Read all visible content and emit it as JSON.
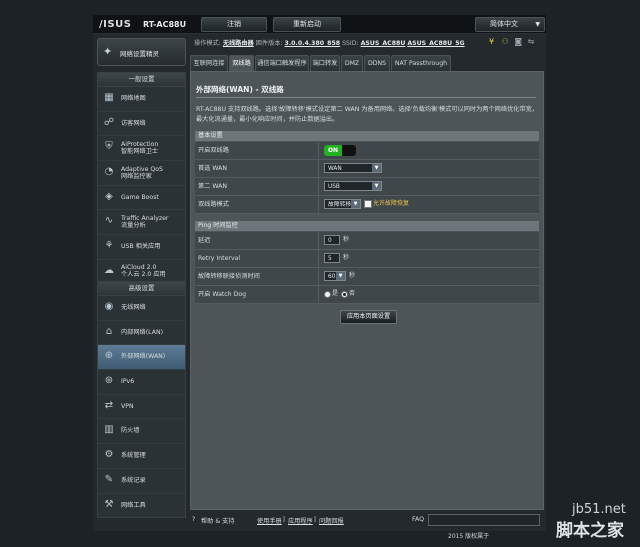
{
  "header": {
    "logo": "/ISUS",
    "model": "RT-AC88U",
    "logout": "注销",
    "reboot": "重新启动",
    "language": "简体中文"
  },
  "status": {
    "mode_label": "操作模式:",
    "mode_value": "无线路由器",
    "firmware_label": "固件版本:",
    "firmware_value": "3.0.0.4.380_858",
    "ssid_label": "SSID:",
    "ssid_1": "ASUS_AC88U",
    "ssid_2": "ASUS_AC88U_5G"
  },
  "nav": {
    "wizard": "网络设置精灵",
    "general_title": "一般设置",
    "general": [
      {
        "icon": "network-map-icon",
        "line1": "网络地图",
        "line2": ""
      },
      {
        "icon": "guest-network-icon",
        "line1": "访客网络",
        "line2": ""
      },
      {
        "icon": "aiprotection-icon",
        "line1": "AiProtection",
        "line2": "智能网络卫士"
      },
      {
        "icon": "adaptive-qos-icon",
        "line1": "Adaptive QoS",
        "line2": "网络监控家"
      },
      {
        "icon": "game-boost-icon",
        "line1": "Game Boost",
        "line2": ""
      },
      {
        "icon": "traffic-analyzer-icon",
        "line1": "Traffic Analyzer",
        "line2": "流量分析"
      },
      {
        "icon": "usb-icon",
        "line1": "USB 相关应用",
        "line2": ""
      },
      {
        "icon": "aicloud-icon",
        "line1": "AiCloud 2.0",
        "line2": "个人云 2.0 应用"
      }
    ],
    "advanced_title": "高级设置",
    "advanced": [
      {
        "icon": "wireless-icon",
        "line1": "无线网络"
      },
      {
        "icon": "lan-icon",
        "line1": "内部网络(LAN)"
      },
      {
        "icon": "wan-icon",
        "line1": "外部网络(WAN)"
      },
      {
        "icon": "ipv6-icon",
        "line1": "IPv6"
      },
      {
        "icon": "vpn-icon",
        "line1": "VPN"
      },
      {
        "icon": "firewall-icon",
        "line1": "防火墙"
      },
      {
        "icon": "admin-icon",
        "line1": "系统管理"
      },
      {
        "icon": "syslog-icon",
        "line1": "系统记录"
      },
      {
        "icon": "network-tools-icon",
        "line1": "网络工具"
      }
    ]
  },
  "tabs": [
    "互联网连接",
    "双线路",
    "通信端口触发程序",
    "端口转发",
    "DMZ",
    "DDNS",
    "NAT Passthrough"
  ],
  "page": {
    "title": "外部网络(WAN) - 双线路",
    "description": "RT-AC88U 支持双线路。选择'故障转移'模式设定第二 WAN 为备用网络。选择'负载均衡'模式可以同时为两个网络优化带宽，最大化流通量，最小化响应时间，并防止数据溢出。",
    "basic_title": "基本设置",
    "enable_label": "开启双线路",
    "toggle_on": "ON",
    "primary_label": "首选 WAN",
    "primary_value": "WAN",
    "secondary_label": "第二 WAN",
    "secondary_value": "USB",
    "mode_label": "双线路模式",
    "mode_value": "故障转移",
    "failback_label": "允许故障恢复",
    "ping_title": "Ping 时间监控",
    "delay_label": "延迟",
    "delay_value": "0",
    "delay_unit": "秒",
    "retry_label": "Retry Interval",
    "retry_value": "5",
    "retry_unit": "秒",
    "detect_label": "故障转移联接侦测时间",
    "detect_value": "60",
    "detect_unit": "秒",
    "watchdog_label": "开启 Watch Dog",
    "yes_label": "是",
    "no_label": "否",
    "apply": "应用本页面设置"
  },
  "footer": {
    "help": "帮助 & 支持",
    "manual": "使用手册",
    "utility": "应用程序",
    "feedback": "问题回报",
    "faq": "FAQ",
    "copyright": "2015 版权属于"
  },
  "watermark": {
    "site": "jb51.net",
    "name": "脚本之家"
  }
}
